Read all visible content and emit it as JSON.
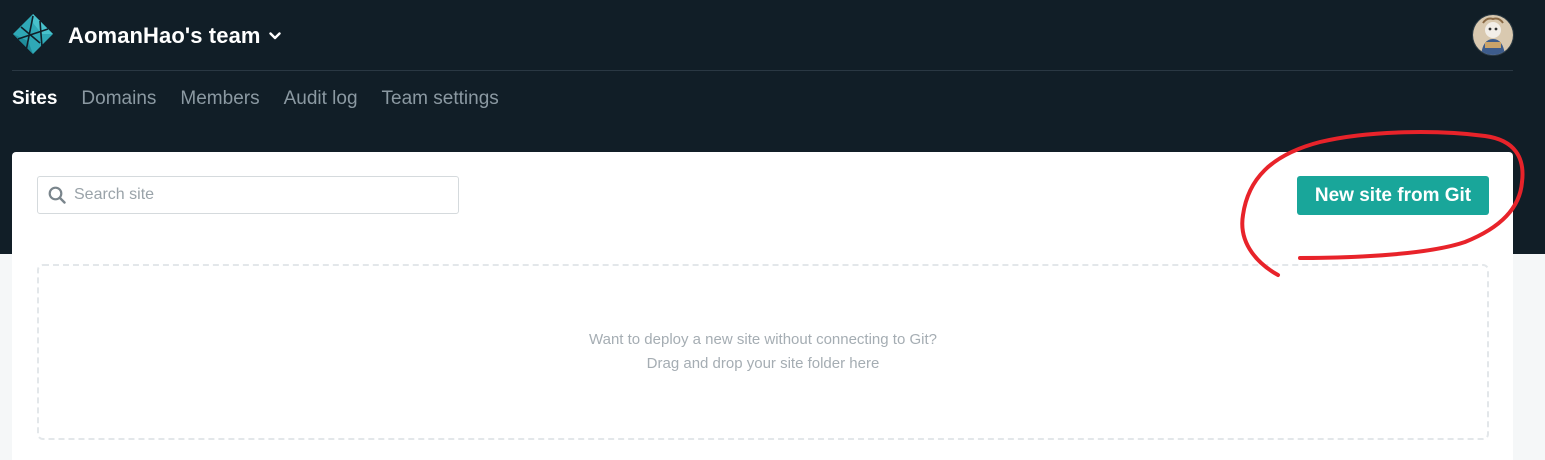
{
  "header": {
    "team_name": "AomanHao's team",
    "logo_icon": "netlify-logo-icon",
    "avatar_icon": "user-avatar"
  },
  "nav": {
    "items": [
      {
        "label": "Sites",
        "active": true
      },
      {
        "label": "Domains",
        "active": false
      },
      {
        "label": "Members",
        "active": false
      },
      {
        "label": "Audit log",
        "active": false
      },
      {
        "label": "Team settings",
        "active": false
      }
    ]
  },
  "search": {
    "placeholder": "Search site",
    "value": ""
  },
  "actions": {
    "new_site_label": "New site from Git"
  },
  "dropzone": {
    "line1": "Want to deploy a new site without connecting to Git?",
    "line2": "Drag and drop your site folder here"
  },
  "colors": {
    "topbar": "#111e27",
    "accent": "#19a69a",
    "annotation": "#e8232a"
  }
}
